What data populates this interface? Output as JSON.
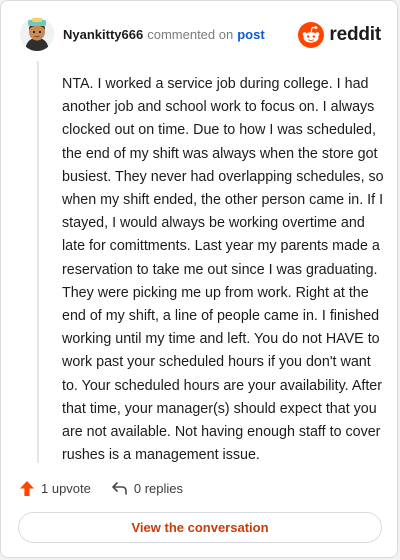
{
  "header": {
    "username": "Nyankitty666",
    "action_text": "commented on",
    "target_text": "post",
    "brand": "reddit"
  },
  "comment": {
    "body": "NTA. I worked a service job during college. I had another job and school work to focus on. I always clocked out on time. Due to how I was scheduled, the end of my shift was always when the store got busiest. They never had overlapping schedules, so when my shift ended, the other person came in. If I stayed, I would always be working overtime and late for comittments. Last year my parents made a reservation to take me out since I was graduating. They were picking me up from work. Right at the end of my shift, a line of people came in. I finished working until my time and left. You do not HAVE to work past your scheduled hours if you don't want to. Your scheduled hours are your availability. After that time, your manager(s) should expect that you are not available. Not having enough staff to cover rushes is a management issue."
  },
  "actions": {
    "upvote_label": "1 upvote",
    "replies_label": "0 replies"
  },
  "footer": {
    "view_button_label": "View the conversation"
  },
  "colors": {
    "brand_orange": "#ff4500",
    "link_blue": "#0b5cd6",
    "button_text": "#c93c0a"
  }
}
